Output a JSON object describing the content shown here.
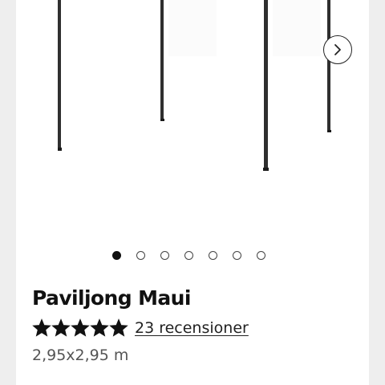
{
  "product": {
    "title": "Paviljong Maui",
    "rating": 5,
    "rating_max": 5,
    "reviews_text": "23 recensioner",
    "size": "2,95x2,95 m"
  },
  "gallery": {
    "slide_count": 7,
    "active_slide": 1,
    "next_icon": "chevron-right-icon"
  },
  "colors": {
    "page_bg": "#eeeeee",
    "card_bg": "#ffffff",
    "text": "#111111",
    "muted_text": "#555555",
    "pole": "#2f2f2f"
  }
}
